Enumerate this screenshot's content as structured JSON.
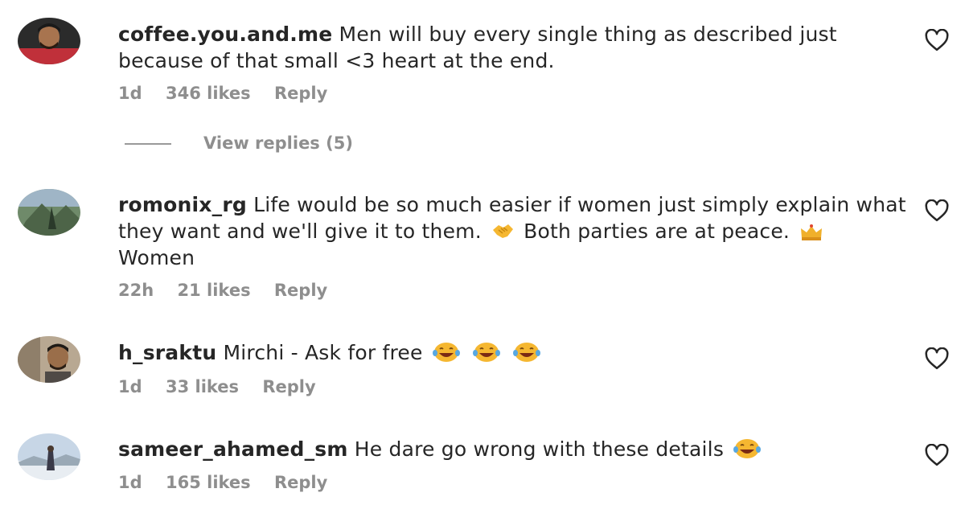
{
  "comments": [
    {
      "username": "coffee.you.and.me",
      "text_parts": [
        "Men will buy every single thing as described just because of that small <3 heart at the end."
      ],
      "time": "1d",
      "likes": "346 likes",
      "reply_label": "Reply",
      "view_replies": "View replies (5)"
    },
    {
      "username": "romonix_rg",
      "text_parts": [
        "Life would be so much easier if women just simply explain what they want and we'll give it to them.",
        "Both parties are at peace.",
        "Women"
      ],
      "emojis": [
        "handshake-emoji",
        "crown-emoji"
      ],
      "time": "22h",
      "likes": "21 likes",
      "reply_label": "Reply"
    },
    {
      "username": "h_sraktu",
      "text_parts": [
        "Mirchi - Ask for free"
      ],
      "emojis": [
        "laughing-emoji",
        "laughing-emoji",
        "laughing-emoji"
      ],
      "time": "1d",
      "likes": "33 likes",
      "reply_label": "Reply"
    },
    {
      "username": "sameer_ahamed_sm",
      "text_parts": [
        "He dare go wrong with these details"
      ],
      "emojis": [
        "laughing-emoji"
      ],
      "time": "1d",
      "likes": "165 likes",
      "reply_label": "Reply"
    }
  ],
  "icons": {
    "like": "heart-outline-icon"
  },
  "colors": {
    "text": "#262626",
    "secondary": "#8e8e8e",
    "emoji_yellow": "#f5b731"
  }
}
